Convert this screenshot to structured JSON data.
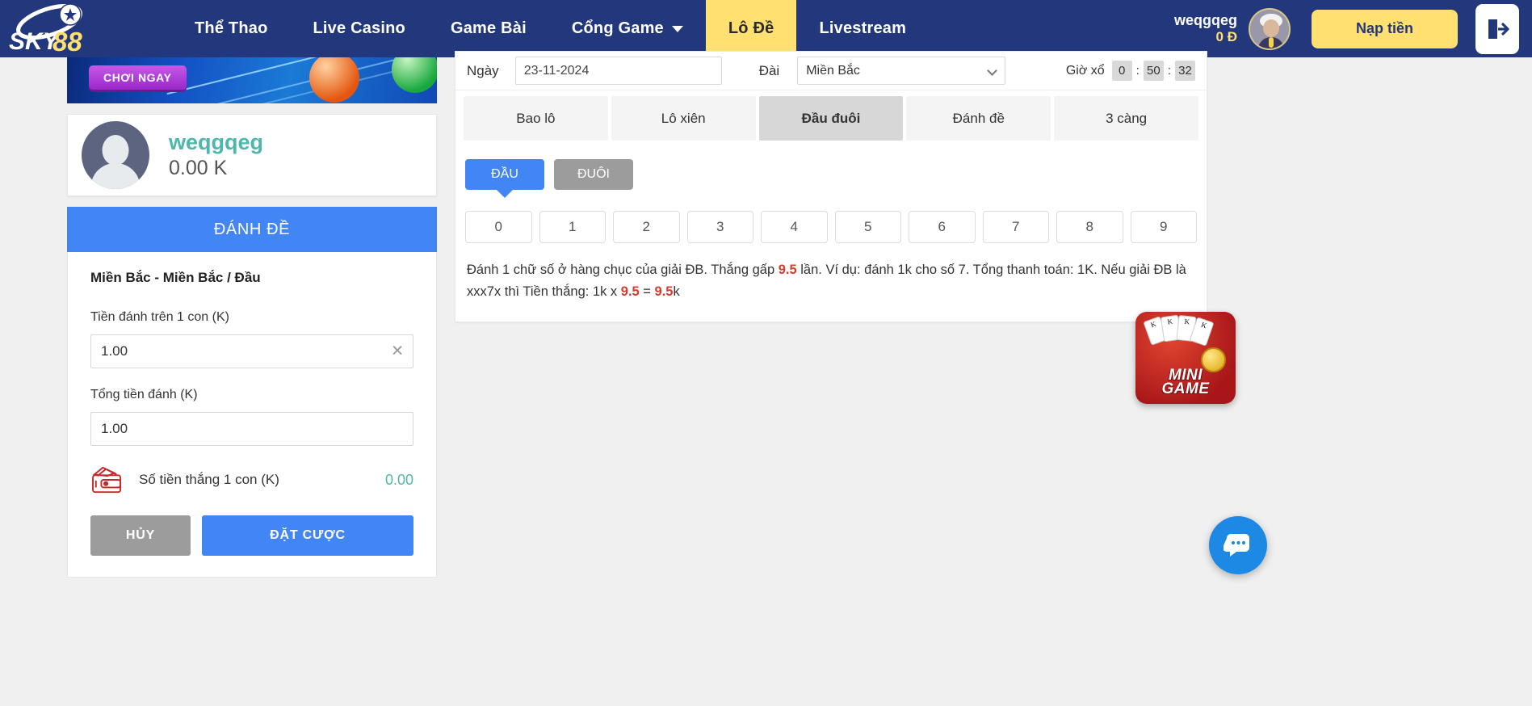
{
  "header": {
    "logo_text": "SKY88",
    "nav": [
      {
        "label": "Thể Thao",
        "active": false,
        "caret": false
      },
      {
        "label": "Live Casino",
        "active": false,
        "caret": false
      },
      {
        "label": "Game Bài",
        "active": false,
        "caret": false
      },
      {
        "label": "Cổng Game",
        "active": false,
        "caret": true
      },
      {
        "label": "Lô Đề",
        "active": true,
        "caret": false
      },
      {
        "label": "Livestream",
        "active": false,
        "caret": false
      }
    ],
    "user_name": "weqgqeg",
    "user_balance": "0 Đ",
    "deposit_label": "Nạp tiền",
    "logout_icon": "logout-icon"
  },
  "left": {
    "banner_cta": "CHƠI NGAY",
    "profile": {
      "name": "weqgqeg",
      "balance": "0.00 K"
    },
    "bet": {
      "title": "ĐÁNH ĐỀ",
      "subtitle": "Miền Bắc - Miền Bắc / Đầu",
      "amount_label": "Tiền đánh trên 1 con (K)",
      "amount_value": "1.00",
      "total_label": "Tổng tiền đánh (K)",
      "total_value": "1.00",
      "win_label": "Số tiền thắng 1 con (K)",
      "win_value": "0.00",
      "cancel_label": "HỦY",
      "submit_label": "ĐẶT CƯỢC"
    }
  },
  "right": {
    "date_label": "Ngày",
    "date_value": "23-11-2024",
    "station_label": "Đài",
    "station_value": "Miền Bắc",
    "timer_label": "Giờ xổ",
    "timer": {
      "hours": "0",
      "minutes": "50",
      "seconds": "32",
      "sep": ":"
    },
    "tabs": [
      {
        "label": "Bao lô",
        "active": false
      },
      {
        "label": "Lô xiên",
        "active": false
      },
      {
        "label": "Đầu đuôi",
        "active": true
      },
      {
        "label": "Đánh đề",
        "active": false
      },
      {
        "label": "3 càng",
        "active": false
      }
    ],
    "toggles": [
      {
        "label": "ĐẦU",
        "active": true
      },
      {
        "label": "ĐUÔI",
        "active": false
      }
    ],
    "numbers": [
      "0",
      "1",
      "2",
      "3",
      "4",
      "5",
      "6",
      "7",
      "8",
      "9"
    ],
    "description": {
      "p1": "Đánh 1 chữ số ở hàng chục của giải ĐB. Thắng gấp ",
      "rate1": "9.5",
      "p2": " lần. Ví dụ: đánh 1k cho số 7. Tổng thanh toán: 1K. Nếu giải ĐB là xxx7x thì Tiền thắng: 1k x ",
      "rate2": "9.5",
      "p3": " = ",
      "rate3": "9.5",
      "p4": "k"
    }
  },
  "floating": {
    "minigame_line1": "MINI",
    "minigame_line2": "GAME",
    "chat_icon": "chat-icon"
  }
}
